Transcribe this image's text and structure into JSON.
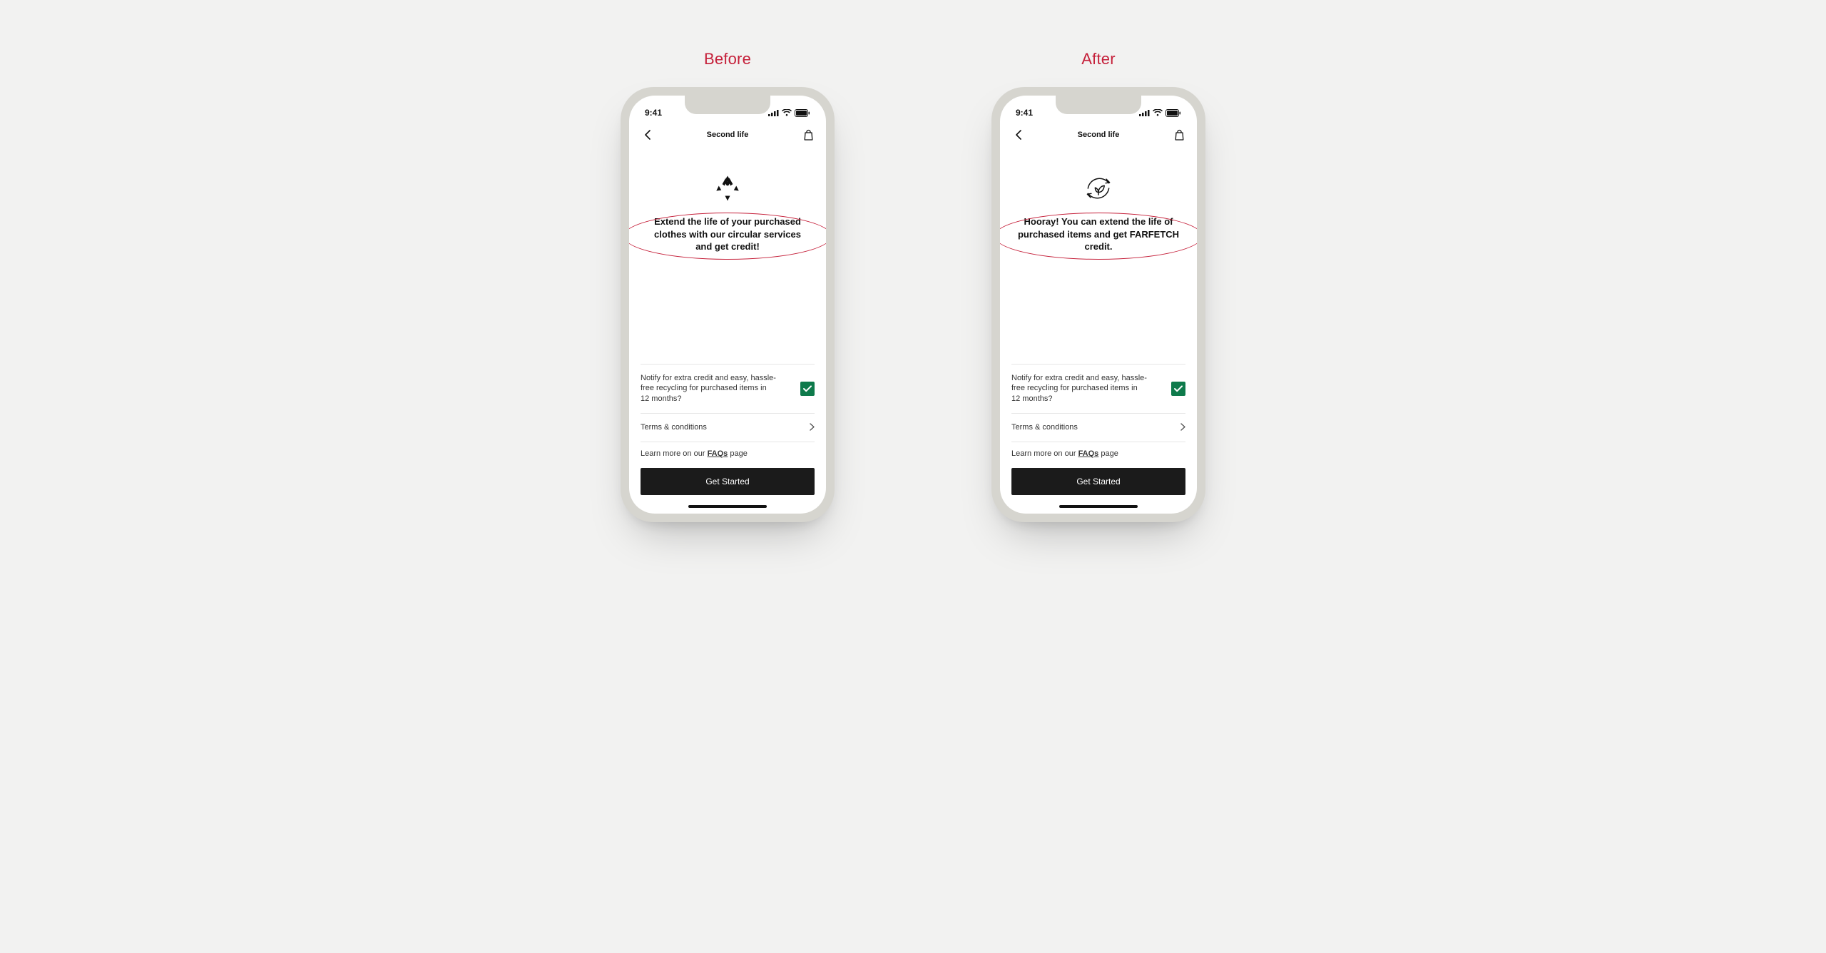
{
  "labels": {
    "before": "Before",
    "after": "After"
  },
  "status": {
    "time": "9:41"
  },
  "nav": {
    "title": "Second life",
    "back_icon": "chevron-left-icon",
    "bag_icon": "shopping-bag-icon"
  },
  "before": {
    "hero_icon": "recycle-icon",
    "hero_text": "Extend the life of your purchased clothes with our circular services and get credit!"
  },
  "after": {
    "hero_icon": "leaf-cycle-icon",
    "hero_text": "Hooray! You can extend the life of purchased items and get FARFETCH credit."
  },
  "rows": {
    "notify": "Notify for extra credit and easy, hassle-free recycling for purchased items in 12 months?",
    "terms": "Terms & conditions"
  },
  "faq": {
    "prefix": "Learn more on our ",
    "link": "FAQs",
    "suffix": " page"
  },
  "cta": "Get Started",
  "colors": {
    "accent": "#c5203a",
    "checkbox": "#0e7a4b",
    "cta_bg": "#1b1b1b"
  }
}
